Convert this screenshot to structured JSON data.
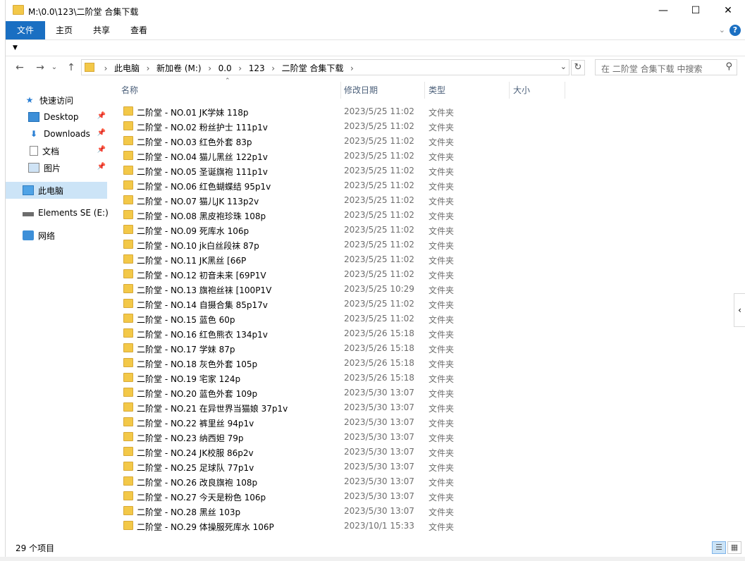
{
  "window": {
    "title": "M:\\0.0\\123\\二阶堂 合集下载",
    "minimize": "—",
    "maximize": "☐",
    "close": "✕"
  },
  "ribbon": {
    "tabs": [
      "文件",
      "主页",
      "共享",
      "查看"
    ],
    "help": "?"
  },
  "nav": {
    "back": "←",
    "forward": "→",
    "recent": "⌄",
    "up": "↑",
    "breadcrumbs": [
      "此电脑",
      "新加卷 (M:)",
      "0.0",
      "123",
      "二阶堂 合集下载"
    ],
    "search_placeholder": "在 二阶堂 合集下载 中搜索"
  },
  "sidebar": {
    "items": [
      {
        "label": "快速访问",
        "icon": "star-icon"
      },
      {
        "label": "Desktop",
        "icon": "desktop-icon",
        "pinned": true
      },
      {
        "label": "Downloads",
        "icon": "download-icon",
        "pinned": true
      },
      {
        "label": "文档",
        "icon": "document-icon",
        "pinned": true
      },
      {
        "label": "图片",
        "icon": "picture-icon",
        "pinned": true
      },
      {
        "label": "此电脑",
        "icon": "computer-icon",
        "selected": true
      },
      {
        "label": "Elements SE (E:)",
        "icon": "drive-icon"
      },
      {
        "label": "网络",
        "icon": "network-icon"
      }
    ]
  },
  "columns": {
    "name": "名称",
    "date": "修改日期",
    "type": "类型",
    "size": "大小"
  },
  "files": [
    {
      "name": "二阶堂 - NO.01 JK学妹 118p",
      "date": "2023/5/25 11:02",
      "type": "文件夹"
    },
    {
      "name": "二阶堂 - NO.02 粉丝护士 111p1v",
      "date": "2023/5/25 11:02",
      "type": "文件夹"
    },
    {
      "name": "二阶堂 - NO.03 红色外套 83p",
      "date": "2023/5/25 11:02",
      "type": "文件夹"
    },
    {
      "name": "二阶堂 - NO.04 猫儿黑丝 122p1v",
      "date": "2023/5/25 11:02",
      "type": "文件夹"
    },
    {
      "name": "二阶堂 - NO.05 圣诞旗袍 111p1v",
      "date": "2023/5/25 11:02",
      "type": "文件夹"
    },
    {
      "name": "二阶堂 - NO.06 红色蝴蝶结 95p1v",
      "date": "2023/5/25 11:02",
      "type": "文件夹"
    },
    {
      "name": "二阶堂 - NO.07 猫儿JK 113p2v",
      "date": "2023/5/25 11:02",
      "type": "文件夹"
    },
    {
      "name": "二阶堂 - NO.08 黑皮袍珍珠 108p",
      "date": "2023/5/25 11:02",
      "type": "文件夹"
    },
    {
      "name": "二阶堂 - NO.09 死库水 106p",
      "date": "2023/5/25 11:02",
      "type": "文件夹"
    },
    {
      "name": "二阶堂 - NO.10 jk白丝段袜 87p",
      "date": "2023/5/25 11:02",
      "type": "文件夹"
    },
    {
      "name": "二阶堂 - NO.11 JK黑丝 [66P",
      "date": "2023/5/25 11:02",
      "type": "文件夹"
    },
    {
      "name": "二阶堂 - NO.12 初音未来 [69P1V",
      "date": "2023/5/25 11:02",
      "type": "文件夹"
    },
    {
      "name": "二阶堂 - NO.13 旗袍丝袜 [100P1V",
      "date": "2023/5/25 10:29",
      "type": "文件夹"
    },
    {
      "name": "二阶堂 - NO.14 自摄合集 85p17v",
      "date": "2023/5/25 11:02",
      "type": "文件夹"
    },
    {
      "name": "二阶堂 - NO.15 蓝色 60p",
      "date": "2023/5/25 11:02",
      "type": "文件夹"
    },
    {
      "name": "二阶堂 - NO.16 红色熊衣 134p1v",
      "date": "2023/5/26 15:18",
      "type": "文件夹"
    },
    {
      "name": "二阶堂 - NO.17 学妹 87p",
      "date": "2023/5/26 15:18",
      "type": "文件夹"
    },
    {
      "name": "二阶堂 - NO.18 灰色外套 105p",
      "date": "2023/5/26 15:18",
      "type": "文件夹"
    },
    {
      "name": "二阶堂 - NO.19 宅家 124p",
      "date": "2023/5/26 15:18",
      "type": "文件夹"
    },
    {
      "name": "二阶堂 - NO.20 蓝色外套 109p",
      "date": "2023/5/30 13:07",
      "type": "文件夹"
    },
    {
      "name": "二阶堂 - NO.21 在异世界当猫娘 37p1v",
      "date": "2023/5/30 13:07",
      "type": "文件夹"
    },
    {
      "name": "二阶堂 - NO.22 裤里丝 94p1v",
      "date": "2023/5/30 13:07",
      "type": "文件夹"
    },
    {
      "name": "二阶堂 - NO.23 纳西妲 79p",
      "date": "2023/5/30 13:07",
      "type": "文件夹"
    },
    {
      "name": "二阶堂 - NO.24 JK校服 86p2v",
      "date": "2023/5/30 13:07",
      "type": "文件夹"
    },
    {
      "name": "二阶堂 - NO.25 足球队 77p1v",
      "date": "2023/5/30 13:07",
      "type": "文件夹"
    },
    {
      "name": "二阶堂 - NO.26 改良旗袍 108p",
      "date": "2023/5/30 13:07",
      "type": "文件夹"
    },
    {
      "name": "二阶堂 - NO.27 今天是粉色 106p",
      "date": "2023/5/30 13:07",
      "type": "文件夹"
    },
    {
      "name": "二阶堂 - NO.28 黑丝 103p",
      "date": "2023/5/30 13:07",
      "type": "文件夹"
    },
    {
      "name": "二阶堂 - NO.29 体操服死库水 106P",
      "date": "2023/10/1 15:33",
      "type": "文件夹"
    }
  ],
  "status": {
    "count": "29 个项目"
  },
  "colors": {
    "accent": "#1a6fc2",
    "folder": "#f3c848",
    "selection": "#cce4f7"
  }
}
